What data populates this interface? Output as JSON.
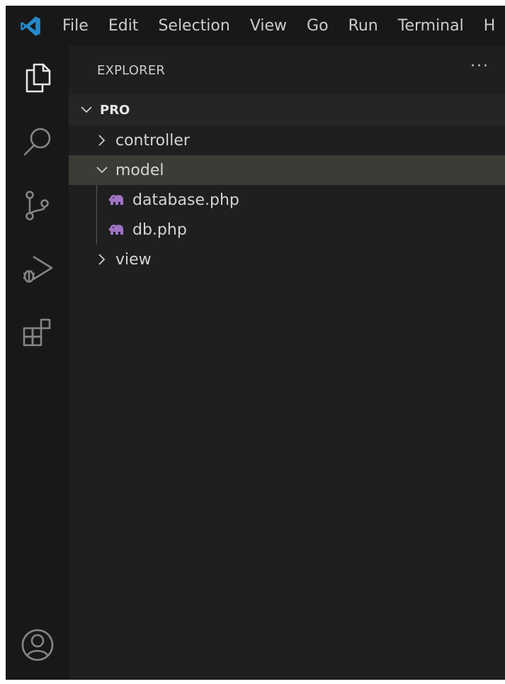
{
  "menubar": {
    "logo_icon": "vscode-logo-icon",
    "items": [
      "File",
      "Edit",
      "Selection",
      "View",
      "Go",
      "Run",
      "Terminal",
      "H"
    ]
  },
  "activitybar": {
    "icons": [
      "explorer-icon",
      "search-icon",
      "source-control-icon",
      "run-debug-icon",
      "extensions-icon"
    ],
    "account_icon": "account-icon"
  },
  "sidebar": {
    "title": "EXPLORER",
    "more": "···",
    "workspace": "PRO",
    "tree": {
      "controller": "controller",
      "model": "model",
      "database_php": "database.php",
      "db_php": "db.php",
      "view": "view"
    }
  },
  "colors": {
    "background": "#1f1f1f",
    "activitybar": "#181818",
    "selected_row": "#3b3c35",
    "php_icon": "#a074c4",
    "vscode_blue": "#2489ca"
  }
}
